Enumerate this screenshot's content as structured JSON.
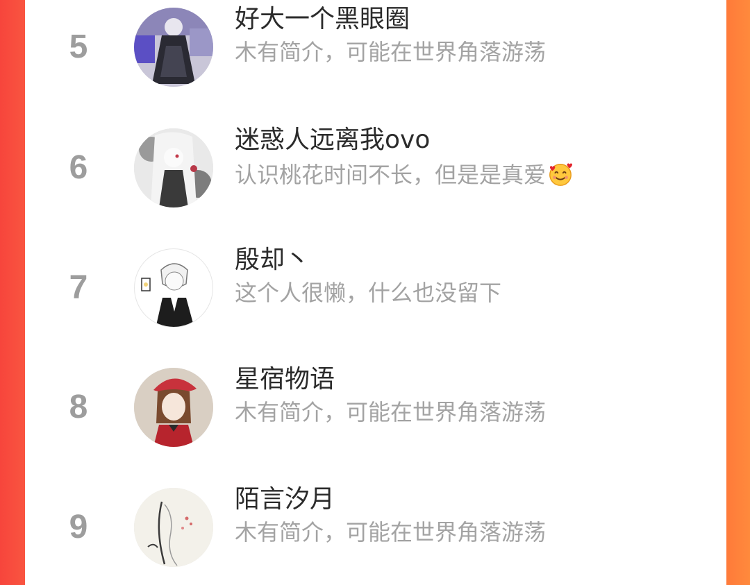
{
  "ranking": {
    "items": [
      {
        "rank": "5",
        "name": "好大一个黑眼圈",
        "bio": "木有简介，可能在世界角落游荡"
      },
      {
        "rank": "6",
        "name": "迷惑人远离我ovo",
        "bio": "认识桃花时间不长，但是是真爱",
        "emoji": "smiling-face-with-hearts"
      },
      {
        "rank": "7",
        "name": "殷却丶",
        "bio": "这个人很懒，什么也没留下"
      },
      {
        "rank": "8",
        "name": "星宿物语",
        "bio": "木有简介，可能在世界角落游荡"
      },
      {
        "rank": "9",
        "name": "陌言汐月",
        "bio": "木有简介，可能在世界角落游荡"
      }
    ]
  },
  "colors": {
    "left_edge": "#f7453c",
    "right_edge": "#ff7a3a",
    "rank_gray": "#9d9d9d",
    "name_text": "#2b2b2b",
    "bio_text": "#a3a3a3"
  }
}
